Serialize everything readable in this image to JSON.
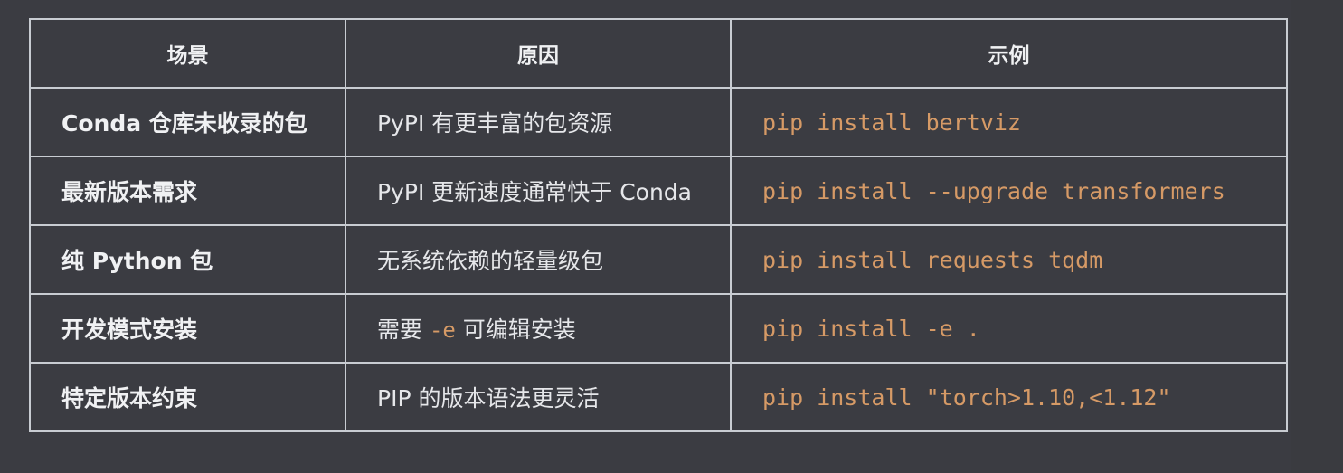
{
  "table": {
    "headers": [
      "场景",
      "原因",
      "示例"
    ],
    "rows": [
      {
        "scene": "Conda 仓库未收录的包",
        "reason_before": "PyPI 有更丰富的包资源",
        "reason_code": "",
        "reason_after": "",
        "example": "pip install bertviz"
      },
      {
        "scene": "最新版本需求",
        "reason_before": "PyPI 更新速度通常快于 Conda",
        "reason_code": "",
        "reason_after": "",
        "example": "pip install --upgrade transformers"
      },
      {
        "scene": "纯 Python 包",
        "reason_before": "无系统依赖的轻量级包",
        "reason_code": "",
        "reason_after": "",
        "example": "pip install requests tqdm"
      },
      {
        "scene": "开发模式安装",
        "reason_before": "需要 ",
        "reason_code": "-e",
        "reason_after": " 可编辑安装",
        "example": "pip install -e ."
      },
      {
        "scene": "特定版本约束",
        "reason_before": "PIP 的版本语法更灵活",
        "reason_code": "",
        "reason_after": "",
        "example": "pip install \"torch>1.10,<1.12\""
      }
    ]
  },
  "colors": {
    "background": "#3b3c42",
    "border": "#c8ccd2",
    "code": "#d69a66",
    "text": "#e6e7ea"
  }
}
